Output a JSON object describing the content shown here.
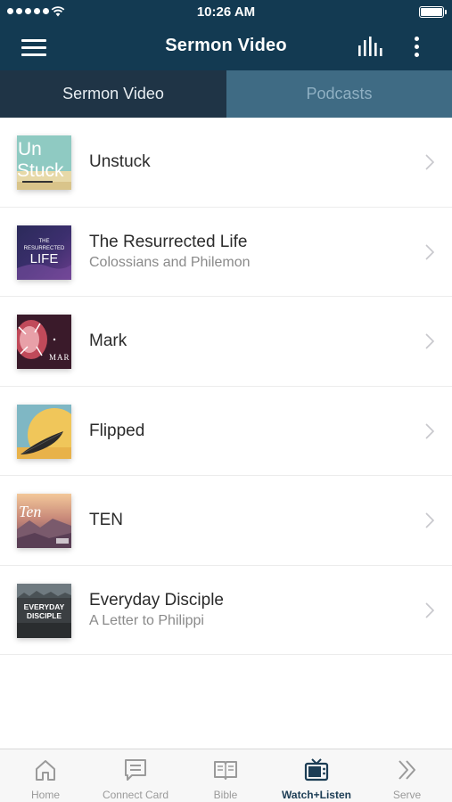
{
  "status_bar": {
    "time": "10:26 AM"
  },
  "nav": {
    "title": "Sermon Video",
    "menu_icon": "hamburger-menu-icon",
    "audio_icon": "audio-bars-icon",
    "more_icon": "more-vertical-icon"
  },
  "tabs": [
    {
      "label": "Sermon Video",
      "active": true
    },
    {
      "label": "Podcasts",
      "active": false
    }
  ],
  "series": [
    {
      "title": "Unstuck",
      "subtitle": "",
      "thumb_text": "Un Stuck"
    },
    {
      "title": "The Resurrected Life",
      "subtitle": "Colossians and Philemon",
      "thumb_text": "THE RESURRECTED LIFE"
    },
    {
      "title": "Mark",
      "subtitle": "",
      "thumb_text": "MAR"
    },
    {
      "title": "Flipped",
      "subtitle": "",
      "thumb_text": ""
    },
    {
      "title": "TEN",
      "subtitle": "",
      "thumb_text": "Ten"
    },
    {
      "title": "Everyday Disciple",
      "subtitle": "A Letter to Philippi",
      "thumb_text": "EVERYDAY DISCIPLE"
    }
  ],
  "bottom_tabs": [
    {
      "label": "Home",
      "icon": "home-icon",
      "active": false
    },
    {
      "label": "Connect Card",
      "icon": "connect-card-icon",
      "active": false
    },
    {
      "label": "Bible",
      "icon": "bible-icon",
      "active": false
    },
    {
      "label": "Watch+Listen",
      "icon": "tv-icon",
      "active": true
    },
    {
      "label": "Serve",
      "icon": "double-chevron-icon",
      "active": false
    }
  ],
  "colors": {
    "header": "#133a52",
    "tab_active": "#1f3446",
    "tab_inactive": "#3f6b84",
    "active_tab_icon": "#1c3d55",
    "inactive_tab_icon": "#9a9a9a"
  }
}
